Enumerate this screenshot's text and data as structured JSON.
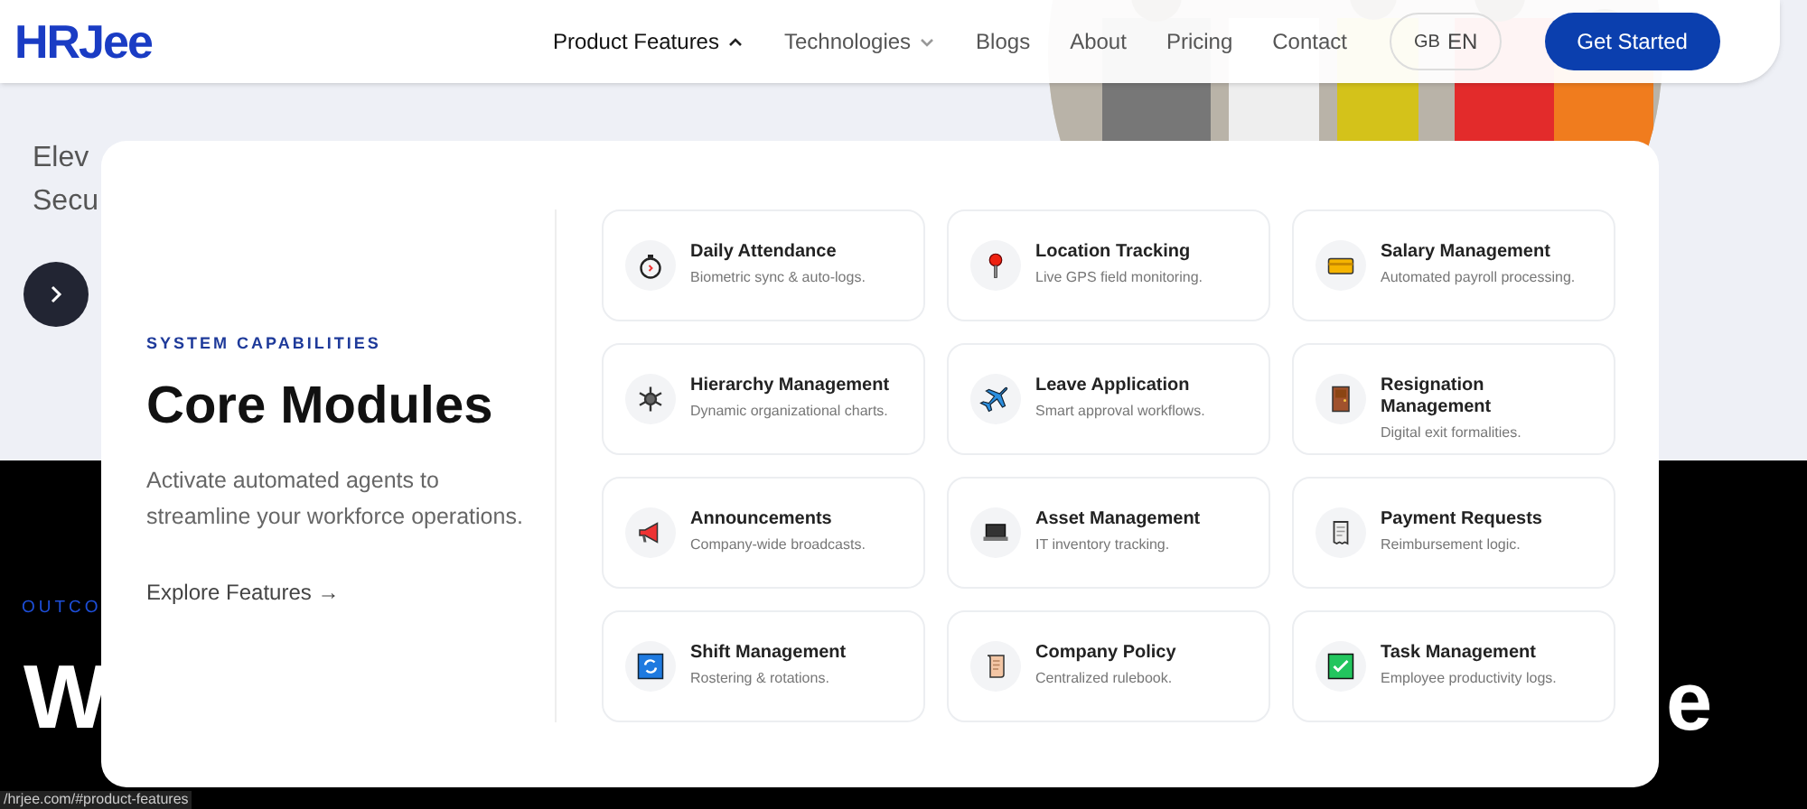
{
  "logo": "HRJee",
  "nav": [
    {
      "label": "Product Features",
      "kind": "dropdown",
      "expanded": true
    },
    {
      "label": "Technologies",
      "kind": "dropdown",
      "expanded": false
    },
    {
      "label": "Blogs",
      "kind": "link"
    },
    {
      "label": "About",
      "kind": "link"
    },
    {
      "label": "Pricing",
      "kind": "link"
    },
    {
      "label": "Contact",
      "kind": "link"
    }
  ],
  "language": {
    "flag": "GB",
    "code": "EN"
  },
  "cta": "Get Started",
  "hero": {
    "lines": [
      "Elev",
      "Secu"
    ],
    "eyebrow": "OUTCO",
    "heading_left": "W",
    "heading_right": "e"
  },
  "menu": {
    "eyebrow": "SYSTEM CAPABILITIES",
    "title": "Core Modules",
    "description": "Activate automated agents to streamline your workforce operations.",
    "link": "Explore Features",
    "link_arrow": "→",
    "modules": [
      {
        "title": "Daily Attendance",
        "subtitle": "Biometric sync & auto-logs."
      },
      {
        "title": "Location Tracking",
        "subtitle": "Live GPS field monitoring."
      },
      {
        "title": "Salary Management",
        "subtitle": "Automated payroll processing."
      },
      {
        "title": "Hierarchy Management",
        "subtitle": "Dynamic organizational charts."
      },
      {
        "title": "Leave Application",
        "subtitle": "Smart approval workflows."
      },
      {
        "title": "Resignation Management",
        "subtitle": "Digital exit formalities."
      },
      {
        "title": "Announcements",
        "subtitle": "Company-wide broadcasts."
      },
      {
        "title": "Asset Management",
        "subtitle": "IT inventory tracking."
      },
      {
        "title": "Payment Requests",
        "subtitle": "Reimbursement logic."
      },
      {
        "title": "Shift Management",
        "subtitle": "Rostering & rotations."
      },
      {
        "title": "Company Policy",
        "subtitle": "Centralized rulebook."
      },
      {
        "title": "Task Management",
        "subtitle": "Employee productivity logs."
      }
    ]
  },
  "status_url": "/hrjee.com/#product-features"
}
